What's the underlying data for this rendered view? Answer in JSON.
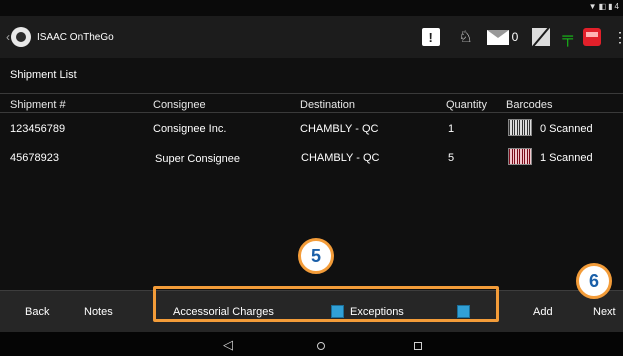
{
  "app": {
    "title": "ISAAC OnTheGo",
    "mail_count": "0"
  },
  "page": {
    "title": "Shipment List"
  },
  "table": {
    "headers": [
      "Shipment #",
      "Consignee",
      "Destination",
      "Quantity",
      "Barcodes"
    ],
    "rows": [
      {
        "shipment": "123456789",
        "consignee": "Consignee Inc.",
        "destination": "CHAMBLY - QC",
        "quantity": "1",
        "barcodes": "0 Scanned"
      },
      {
        "shipment": "45678923",
        "consignee": "Super Consignee",
        "destination": "CHAMBLY - QC",
        "quantity": "5",
        "barcodes": "1 Scanned"
      }
    ]
  },
  "bottom": {
    "back": "Back",
    "notes": "Notes",
    "accessorial": "Accessorial Charges",
    "exceptions": "Exceptions",
    "add": "Add",
    "next": "Next"
  },
  "callouts": {
    "c5": "5",
    "c6": "6"
  },
  "colors": {
    "accent_orange": "#f39c39",
    "checkbox_blue": "#31a0d6",
    "bus_red": "#e2202a",
    "green": "#18c418"
  },
  "icons": [
    "alert-icon",
    "bell-icon",
    "mail-icon",
    "no-signal-icon",
    "plug-icon",
    "bus-icon",
    "overflow-menu-icon",
    "barcode-icon"
  ]
}
